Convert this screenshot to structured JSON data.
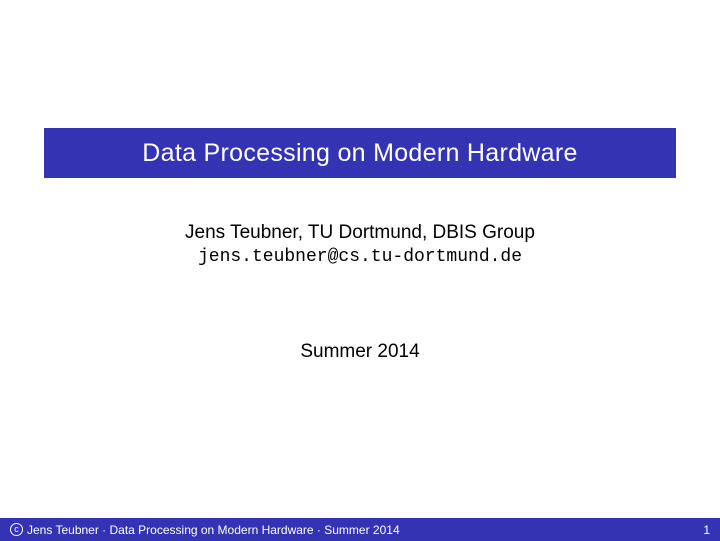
{
  "title": "Data Processing on Modern Hardware",
  "author": "Jens Teubner, TU Dortmund, DBIS Group",
  "email": "jens.teubner@cs.tu-dortmund.de",
  "term": "Summer 2014",
  "footer": {
    "copyright_symbol": "c",
    "text": "Jens Teubner · Data Processing on Modern Hardware · Summer 2014",
    "page": "1"
  }
}
